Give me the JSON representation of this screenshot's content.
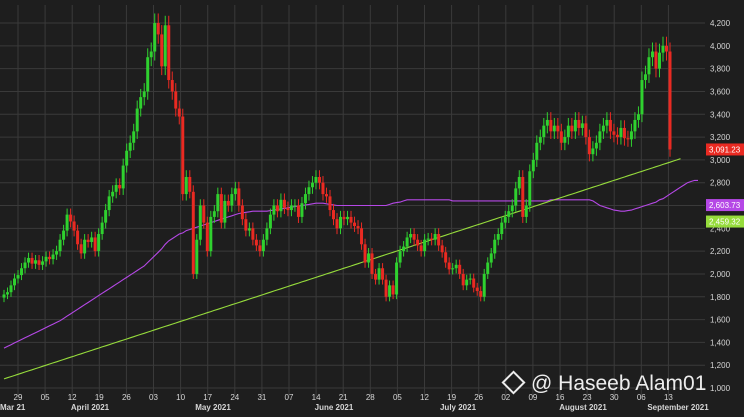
{
  "watermark": {
    "text": "@ Haseeb Alam01",
    "icon": "binance-diamond-icon"
  },
  "colors": {
    "background": "#1e1e1e",
    "grid": "#3a3a3a",
    "up": "#2fd12f",
    "down": "#ea2a22",
    "ma_fast": "#b548e6",
    "ma_slow": "#96dc3c",
    "axis_text": "#d6d6d6"
  },
  "chart_data": {
    "type": "candlestick",
    "title": "",
    "xlabel": "",
    "ylabel": "",
    "ylim": [
      1000,
      4200
    ],
    "y_ticks": [
      1000,
      1200,
      1400,
      1600,
      1800,
      2000,
      2200,
      2400,
      2600,
      2800,
      3000,
      3200,
      3400,
      3600,
      3800,
      4000,
      4200
    ],
    "y_tick_labels": [
      "1,000",
      "1,200",
      "1,400",
      "1,600",
      "1,800",
      "2,000",
      "2,200",
      "2,400",
      "2,600",
      "2,800",
      "3,000",
      "3,200",
      "3,400",
      "3,600",
      "3,800",
      "4,000",
      "4,200"
    ],
    "x_day_labels": [
      "29",
      "05",
      "12",
      "19",
      "26",
      "03",
      "10",
      "17",
      "24",
      "31",
      "07",
      "14",
      "21",
      "28",
      "05",
      "12",
      "19",
      "26",
      "02",
      "09",
      "16",
      "23",
      "30",
      "06",
      "13"
    ],
    "x_month_labels": [
      "Mar 21",
      "April 2021",
      "May 2021",
      "June 2021",
      "July 2021",
      "August 2021",
      "September 2021"
    ],
    "grid": true,
    "price_labels": [
      {
        "text": "3,091.23",
        "value": 3091.23,
        "color": "#ea2a22"
      },
      {
        "text": "2,603.73",
        "value": 2603.73,
        "color": "#b548e6"
      },
      {
        "text": "2,459.32",
        "value": 2459.32,
        "color": "#96dc3c"
      }
    ],
    "series": [
      {
        "name": "",
        "kind": "candles",
        "closes": [
          1820,
          1840,
          1900,
          1960,
          1990,
          2050,
          2100,
          2140,
          2090,
          2120,
          2080,
          2110,
          2150,
          2130,
          2170,
          2200,
          2300,
          2380,
          2520,
          2460,
          2380,
          2260,
          2180,
          2300,
          2280,
          2320,
          2200,
          2350,
          2450,
          2560,
          2680,
          2720,
          2780,
          2750,
          2950,
          3080,
          3150,
          3250,
          3450,
          3550,
          3600,
          3900,
          3950,
          4200,
          4100,
          3820,
          4180,
          3700,
          3600,
          3450,
          3380,
          2700,
          2850,
          2720,
          2000,
          2300,
          2600,
          2450,
          2200,
          2500,
          2550,
          2700,
          2450,
          2640,
          2600,
          2700,
          2750,
          2600,
          2480,
          2380,
          2400,
          2300,
          2250,
          2200,
          2300,
          2400,
          2520,
          2600,
          2550,
          2650,
          2580,
          2560,
          2600,
          2600,
          2500,
          2620,
          2700,
          2760,
          2800,
          2850,
          2800,
          2700,
          2680,
          2560,
          2480,
          2400,
          2500,
          2480,
          2500,
          2450,
          2420,
          2400,
          2260,
          2100,
          2180,
          2000,
          1950,
          2050,
          1950,
          1800,
          1900,
          1820,
          2100,
          2200,
          2240,
          2320,
          2350,
          2300,
          2250,
          2200,
          2300,
          2310,
          2300,
          2350,
          2250,
          2190,
          2100,
          2040,
          2050,
          2080,
          2000,
          1900,
          1950,
          1960,
          1880,
          1850,
          1800,
          2000,
          2100,
          2180,
          2300,
          2350,
          2450,
          2500,
          2550,
          2600,
          2750,
          2850,
          2500,
          2600,
          2900,
          3000,
          3150,
          3200,
          3300,
          3350,
          3250,
          3300,
          3250,
          3150,
          3200,
          3300,
          3250,
          3350,
          3280,
          3320,
          3200,
          3050,
          3100,
          3150,
          3250,
          3300,
          3350,
          3250,
          3220,
          3200,
          3280,
          3190,
          3180,
          3250,
          3350,
          3400,
          3700,
          3750,
          3900,
          3950,
          3800,
          3940,
          4000,
          3950,
          3091.23
        ],
        "ma_fast": [
          1350,
          1365,
          1380,
          1395,
          1410,
          1425,
          1440,
          1455,
          1470,
          1485,
          1500,
          1515,
          1530,
          1545,
          1560,
          1575,
          1590,
          1610,
          1630,
          1650,
          1670,
          1690,
          1710,
          1730,
          1750,
          1770,
          1790,
          1810,
          1830,
          1850,
          1870,
          1890,
          1910,
          1930,
          1950,
          1970,
          1990,
          2010,
          2030,
          2050,
          2070,
          2100,
          2130,
          2160,
          2190,
          2220,
          2260,
          2290,
          2310,
          2330,
          2350,
          2360,
          2380,
          2390,
          2400,
          2410,
          2420,
          2430,
          2440,
          2450,
          2460,
          2470,
          2480,
          2490,
          2500,
          2510,
          2520,
          2530,
          2535,
          2540,
          2545,
          2550,
          2550,
          2550,
          2550,
          2550,
          2555,
          2560,
          2565,
          2570,
          2575,
          2580,
          2585,
          2590,
          2595,
          2600,
          2605,
          2610,
          2615,
          2620,
          2620,
          2620,
          2615,
          2610,
          2605,
          2600,
          2600,
          2600,
          2600,
          2600,
          2600,
          2600,
          2600,
          2600,
          2600,
          2600,
          2600,
          2600,
          2600,
          2600,
          2610,
          2620,
          2625,
          2630,
          2640,
          2650,
          2650,
          2650,
          2650,
          2650,
          2650,
          2650,
          2650,
          2650,
          2650,
          2650,
          2650,
          2650,
          2640,
          2640,
          2640,
          2640,
          2640,
          2640,
          2640,
          2640,
          2640,
          2640,
          2640,
          2640,
          2640,
          2640,
          2640,
          2640,
          2640,
          2640,
          2640,
          2640,
          2640,
          2640,
          2640,
          2640,
          2640,
          2640,
          2640,
          2640,
          2650,
          2650,
          2650,
          2650,
          2650,
          2650,
          2650,
          2650,
          2650,
          2650,
          2650,
          2650,
          2640,
          2620,
          2600,
          2590,
          2580,
          2570,
          2560,
          2555,
          2550,
          2550,
          2555,
          2560,
          2570,
          2580,
          2590,
          2600,
          2610,
          2620,
          2630,
          2650,
          2660,
          2680,
          2700,
          2720,
          2740,
          2760,
          2780,
          2800,
          2810,
          2820,
          2820
        ],
        "ma_slow": [
          1080,
          1090,
          1100,
          1110,
          1120,
          1130,
          1140,
          1150,
          1160,
          1170,
          1180,
          1190,
          1200,
          1210,
          1220,
          1230,
          1240,
          1250,
          1260,
          1270,
          1280,
          1290,
          1300,
          1310,
          1320,
          1330,
          1340,
          1350,
          1360,
          1370,
          1380,
          1390,
          1400,
          1410,
          1420,
          1430,
          1440,
          1450,
          1460,
          1470,
          1480,
          1490,
          1500,
          1510,
          1520,
          1530,
          1540,
          1550,
          1560,
          1570,
          1580,
          1590,
          1600,
          1610,
          1620,
          1630,
          1640,
          1650,
          1660,
          1670,
          1680,
          1690,
          1700,
          1710,
          1720,
          1730,
          1740,
          1750,
          1760,
          1770,
          1780,
          1790,
          1800,
          1810,
          1820,
          1830,
          1840,
          1850,
          1860,
          1870,
          1880,
          1890,
          1900,
          1910,
          1920,
          1930,
          1940,
          1950,
          1960,
          1970,
          1980,
          1990,
          2000,
          2010,
          2020,
          2030,
          2040,
          2050,
          2060,
          2070,
          2080,
          2090,
          2100,
          2110,
          2120,
          2130,
          2140,
          2150,
          2160,
          2170,
          2180,
          2190,
          2200,
          2210,
          2220,
          2230,
          2240,
          2250,
          2260,
          2270,
          2280,
          2290,
          2300,
          2310,
          2320,
          2330,
          2340,
          2350,
          2360,
          2370,
          2380,
          2390,
          2400,
          2410,
          2420,
          2430,
          2440,
          2450,
          2460,
          2470,
          2480,
          2490,
          2500,
          2510,
          2520,
          2530,
          2540,
          2550,
          2560,
          2570,
          2580,
          2590,
          2600,
          2610,
          2620,
          2630,
          2640,
          2650,
          2660,
          2670,
          2680,
          2690,
          2700,
          2710,
          2720,
          2730,
          2740,
          2750,
          2760,
          2770,
          2780,
          2790,
          2800,
          2810,
          2820,
          2830,
          2840,
          2850,
          2860,
          2870,
          2880,
          2890,
          2900,
          2910,
          2920,
          2930,
          2940,
          2950,
          2960,
          2970,
          2980,
          2990,
          3000,
          3010
        ]
      }
    ]
  }
}
